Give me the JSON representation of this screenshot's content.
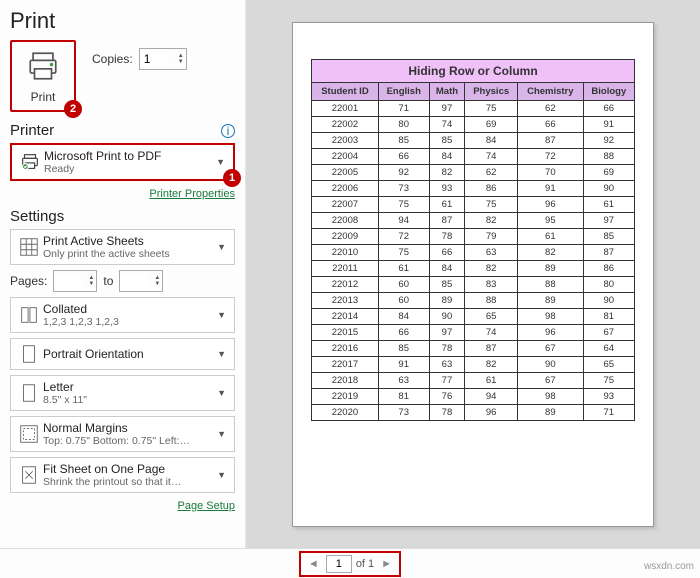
{
  "title": "Print",
  "print_button_label": "Print",
  "copies": {
    "label": "Copies:",
    "value": "1"
  },
  "badges": {
    "printer": "1",
    "print_btn": "2"
  },
  "printer_section": {
    "heading": "Printer",
    "name": "Microsoft Print to PDF",
    "status": "Ready",
    "properties_link": "Printer Properties"
  },
  "settings_section": {
    "heading": "Settings",
    "items": [
      {
        "t1": "Print Active Sheets",
        "t2": "Only print the active sheets"
      },
      {
        "t1": "Collated",
        "t2": "1,2,3   1,2,3   1,2,3"
      },
      {
        "t1": "Portrait Orientation",
        "t2": ""
      },
      {
        "t1": "Letter",
        "t2": "8.5\" x 11\""
      },
      {
        "t1": "Normal Margins",
        "t2": "Top: 0.75\" Bottom: 0.75\" Left:…"
      },
      {
        "t1": "Fit Sheet on One Page",
        "t2": "Shrink the printout so that it…"
      }
    ],
    "pages_label": "Pages:",
    "pages_to": "to",
    "page_setup_link": "Page Setup"
  },
  "preview": {
    "worksheet_title": "Hiding Row or Column",
    "headers": [
      "Student ID",
      "English",
      "Math",
      "Physics",
      "Chemistry",
      "Biology"
    ],
    "rows": [
      [
        "22001",
        "71",
        "97",
        "75",
        "62",
        "66"
      ],
      [
        "22002",
        "80",
        "74",
        "69",
        "66",
        "91"
      ],
      [
        "22003",
        "85",
        "85",
        "84",
        "87",
        "92"
      ],
      [
        "22004",
        "66",
        "84",
        "74",
        "72",
        "88"
      ],
      [
        "22005",
        "92",
        "82",
        "62",
        "70",
        "69"
      ],
      [
        "22006",
        "73",
        "93",
        "86",
        "91",
        "90"
      ],
      [
        "22007",
        "75",
        "61",
        "75",
        "96",
        "61"
      ],
      [
        "22008",
        "94",
        "87",
        "82",
        "95",
        "97"
      ],
      [
        "22009",
        "72",
        "78",
        "79",
        "61",
        "85"
      ],
      [
        "22010",
        "75",
        "66",
        "63",
        "82",
        "87"
      ],
      [
        "22011",
        "61",
        "84",
        "82",
        "89",
        "86"
      ],
      [
        "22012",
        "60",
        "85",
        "83",
        "88",
        "80"
      ],
      [
        "22013",
        "60",
        "89",
        "88",
        "89",
        "90"
      ],
      [
        "22014",
        "84",
        "90",
        "65",
        "98",
        "81"
      ],
      [
        "22015",
        "66",
        "97",
        "74",
        "96",
        "67"
      ],
      [
        "22016",
        "85",
        "78",
        "87",
        "67",
        "64"
      ],
      [
        "22017",
        "91",
        "63",
        "82",
        "90",
        "65"
      ],
      [
        "22018",
        "63",
        "77",
        "61",
        "67",
        "75"
      ],
      [
        "22019",
        "81",
        "76",
        "94",
        "98",
        "93"
      ],
      [
        "22020",
        "73",
        "78",
        "96",
        "89",
        "71"
      ]
    ]
  },
  "pager": {
    "current": "1",
    "of_label": "of 1"
  },
  "watermark": "wsxdn.com"
}
